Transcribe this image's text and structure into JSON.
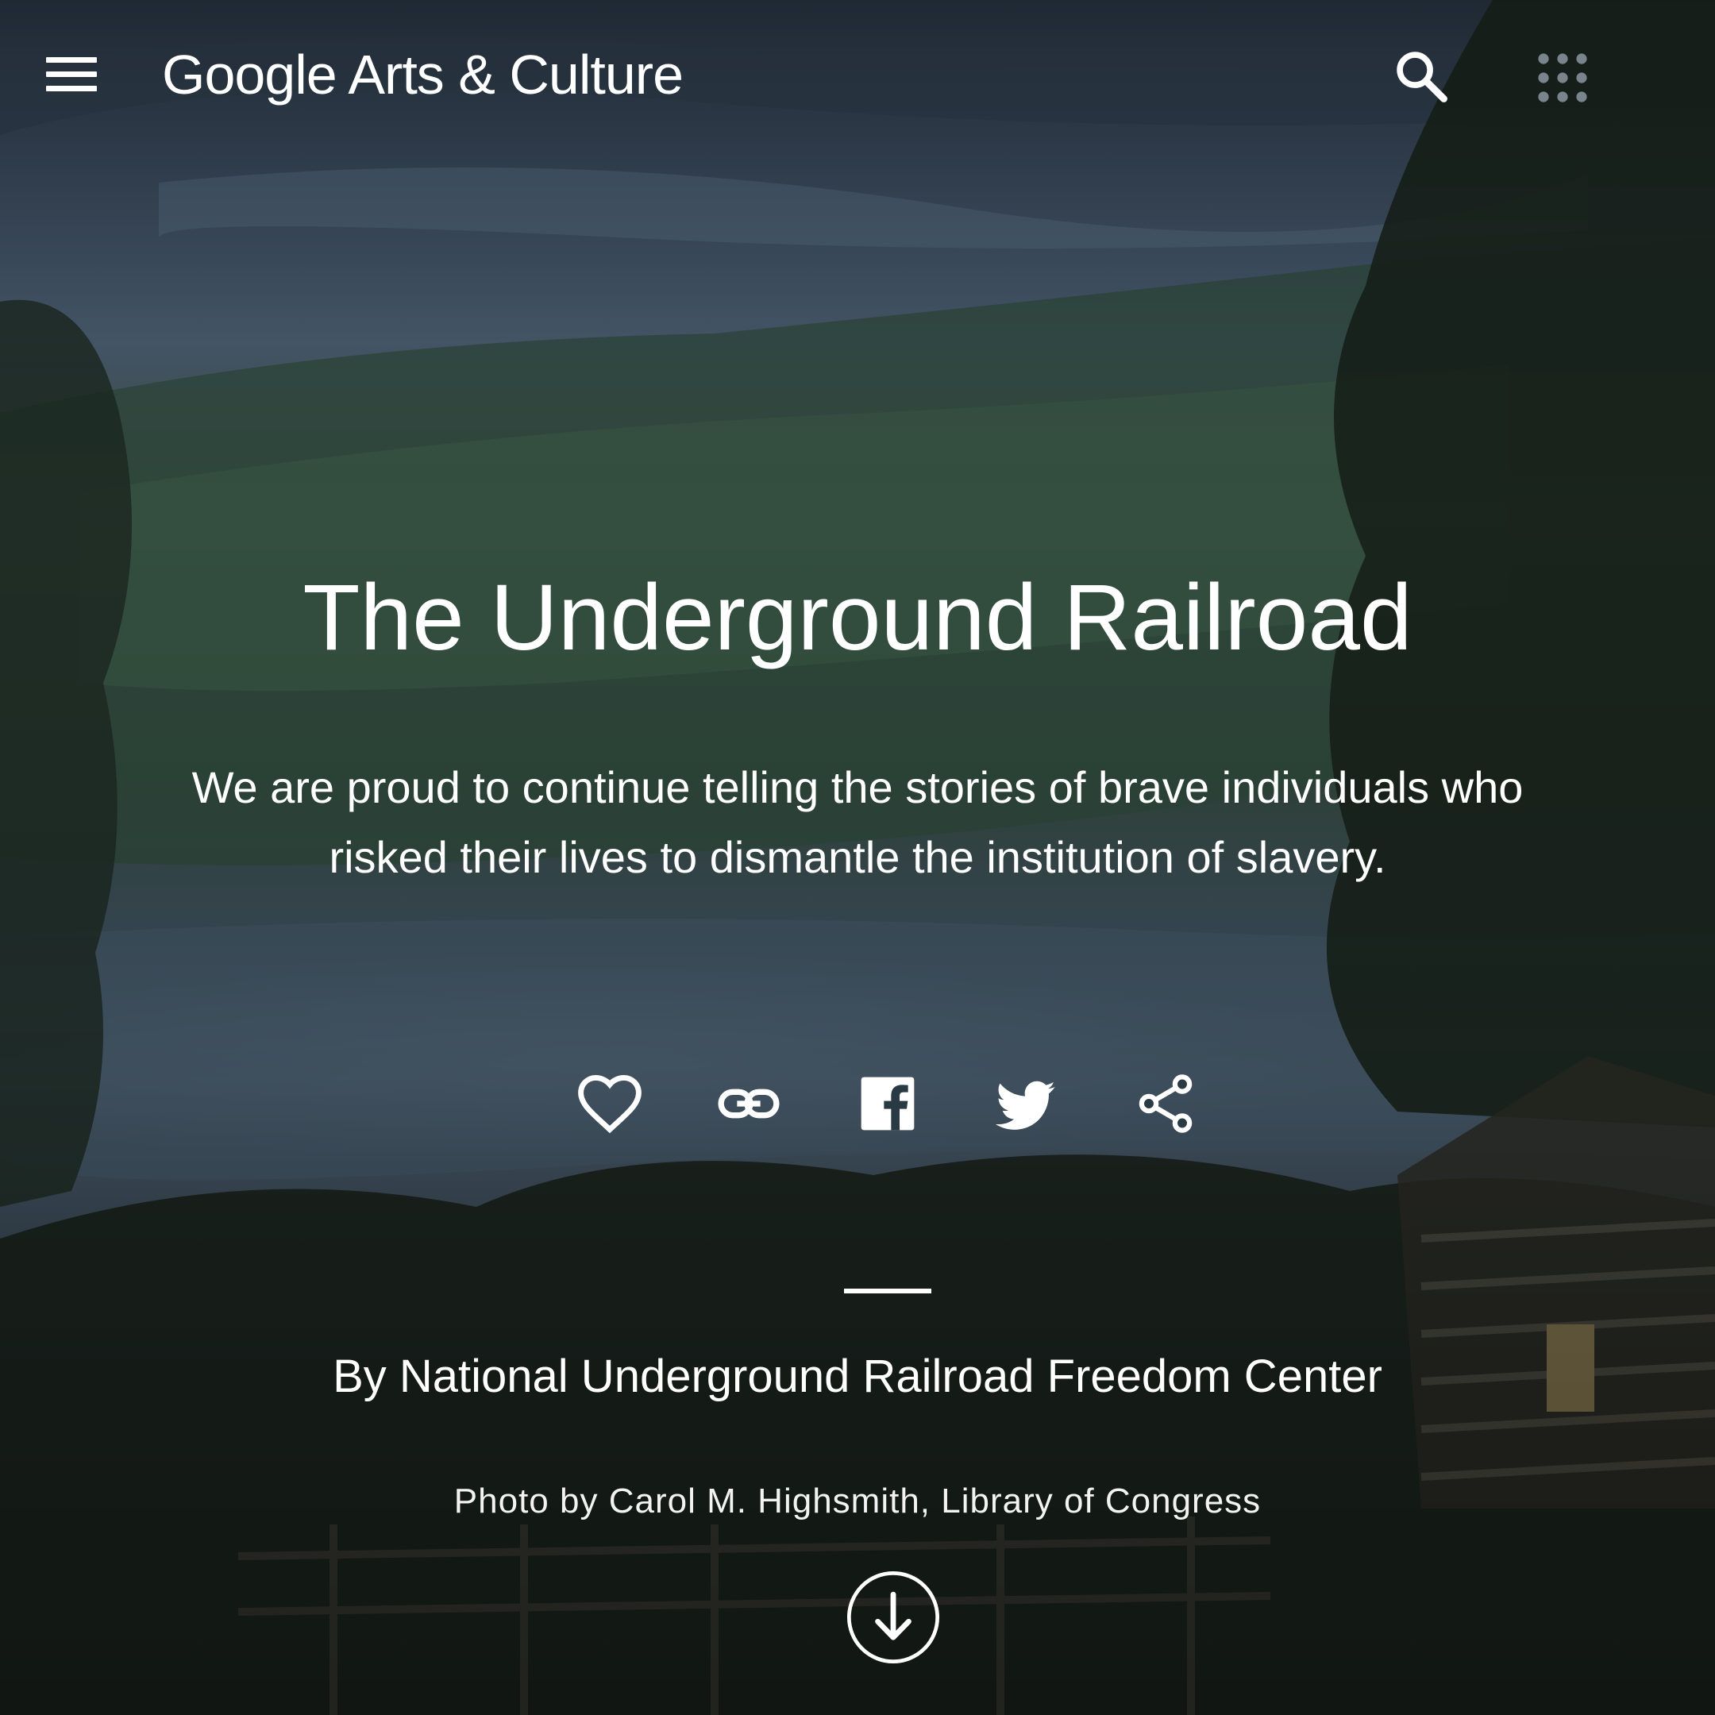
{
  "header": {
    "brand_google": "Google",
    "brand_rest": " Arts & Culture",
    "menu_icon": "hamburger-menu-icon",
    "search_icon": "search-icon",
    "apps_icon": "apps-grid-icon"
  },
  "hero": {
    "title": "The Underground Railroad",
    "subtitle": "We are proud to continue telling the stories of brave individuals who risked their lives to dismantle the institution of slavery.",
    "byline": "By National Underground Railroad Freedom Center",
    "credit": "Photo by Carol M. Highsmith, Library of Congress"
  },
  "actions": [
    {
      "icon": "heart-icon"
    },
    {
      "icon": "link-icon"
    },
    {
      "icon": "facebook-icon"
    },
    {
      "icon": "twitter-icon"
    },
    {
      "icon": "share-icon"
    }
  ],
  "colors": {
    "text": "#ffffff",
    "background": "#1a2630"
  },
  "scroll": {
    "icon": "arrow-down-circle-icon"
  }
}
